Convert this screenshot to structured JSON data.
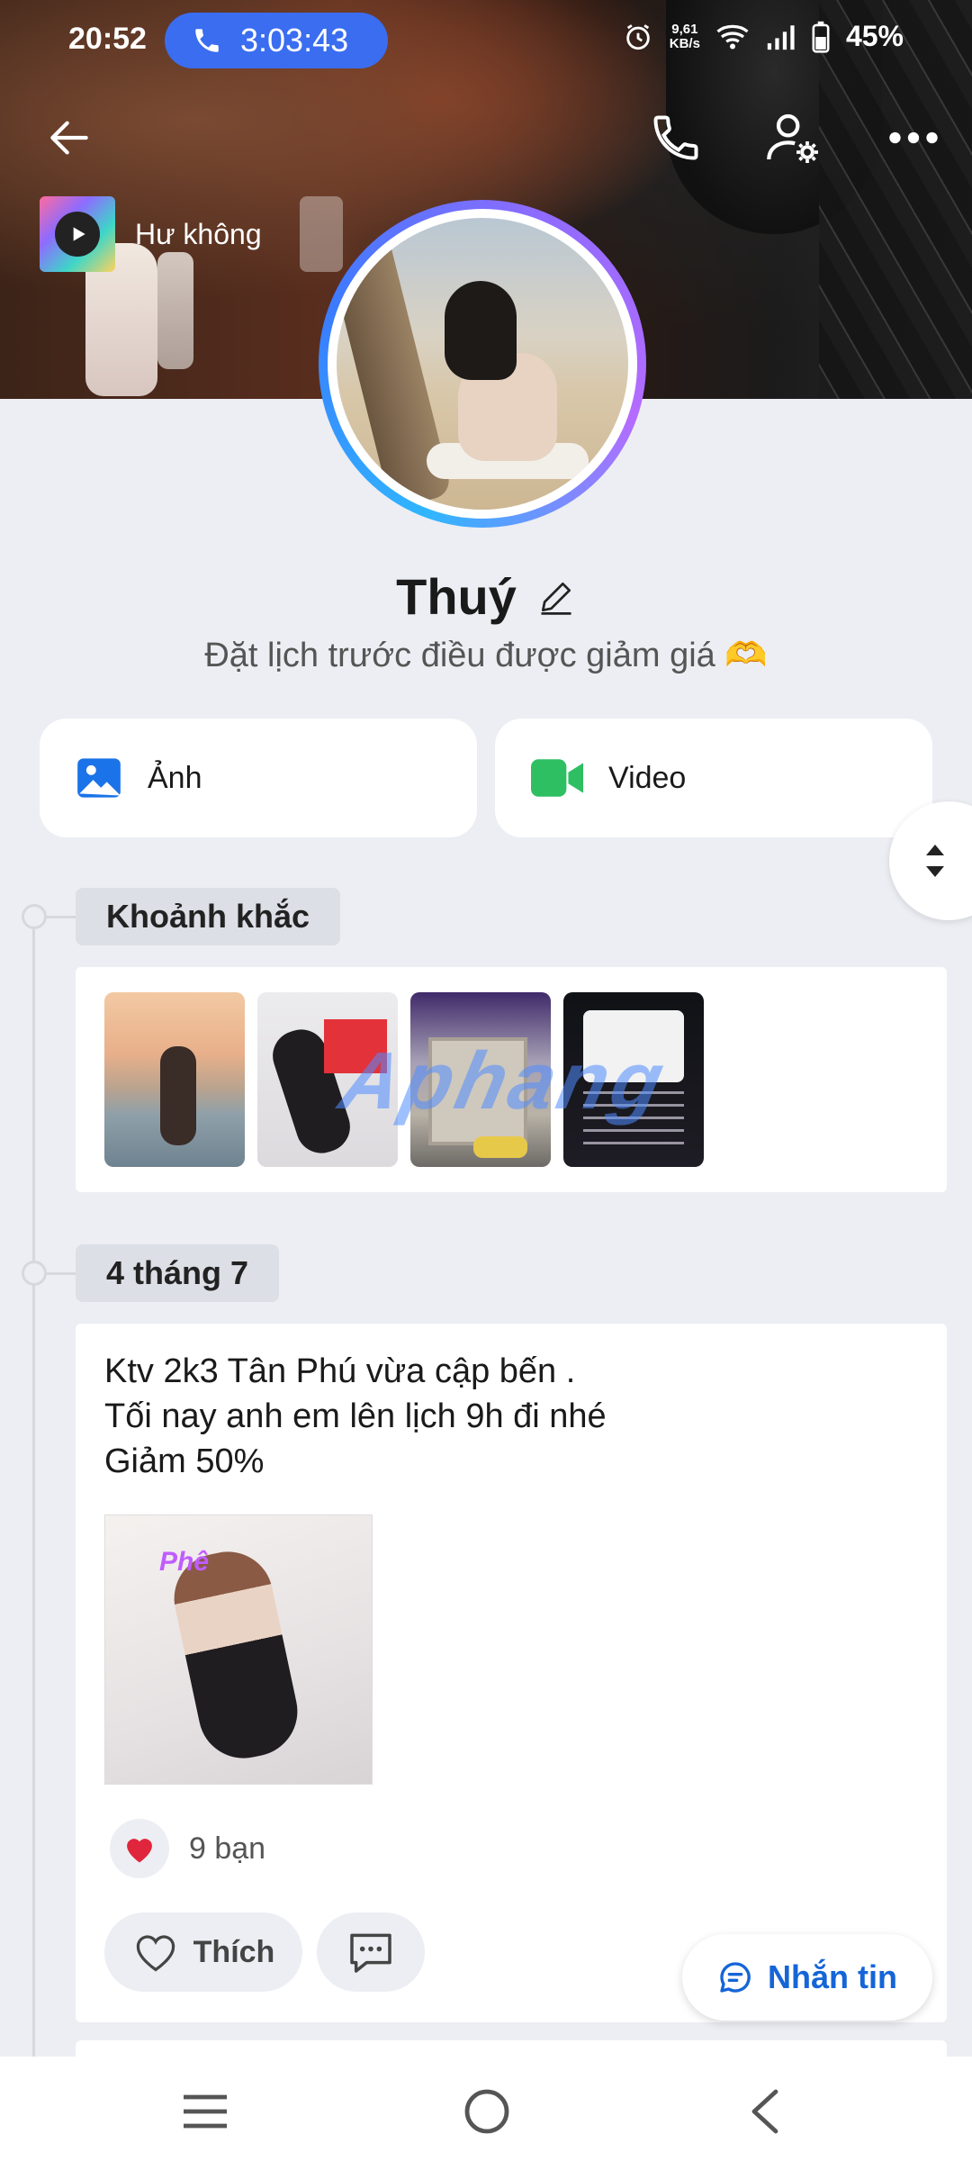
{
  "status_bar": {
    "time": "20:52",
    "call_timer": "3:03:43",
    "net_speed_value": "9,61",
    "net_speed_unit": "KB/s",
    "battery": "45%"
  },
  "music": {
    "title": "Hư không"
  },
  "profile": {
    "name": "Thuý",
    "bio": "Đặt lịch trước điều được giảm giá 🫶"
  },
  "media_buttons": {
    "photos": "Ảnh",
    "videos": "Video"
  },
  "moments": {
    "label": "Khoảnh khắc",
    "watermark": "Aphang"
  },
  "post": {
    "date_label": "4 tháng 7",
    "lines": [
      "Ktv 2k3 Tân Phú vừa cập bến .",
      "Tối nay anh em lên lịch 9h đi nhé",
      "Giảm 50%"
    ],
    "image_tag": "Phê",
    "reaction_count": "9 bạn",
    "like_label": "Thích"
  },
  "message_button": "Nhắn tin",
  "colors": {
    "accent": "#3a6df0",
    "message_text": "#1565d8",
    "video_green": "#2ebf63",
    "heart_red": "#e0263c"
  },
  "icons": {
    "back": "back-arrow-icon",
    "call": "phone-icon",
    "settings": "user-settings-icon",
    "more": "more-dots-icon"
  }
}
